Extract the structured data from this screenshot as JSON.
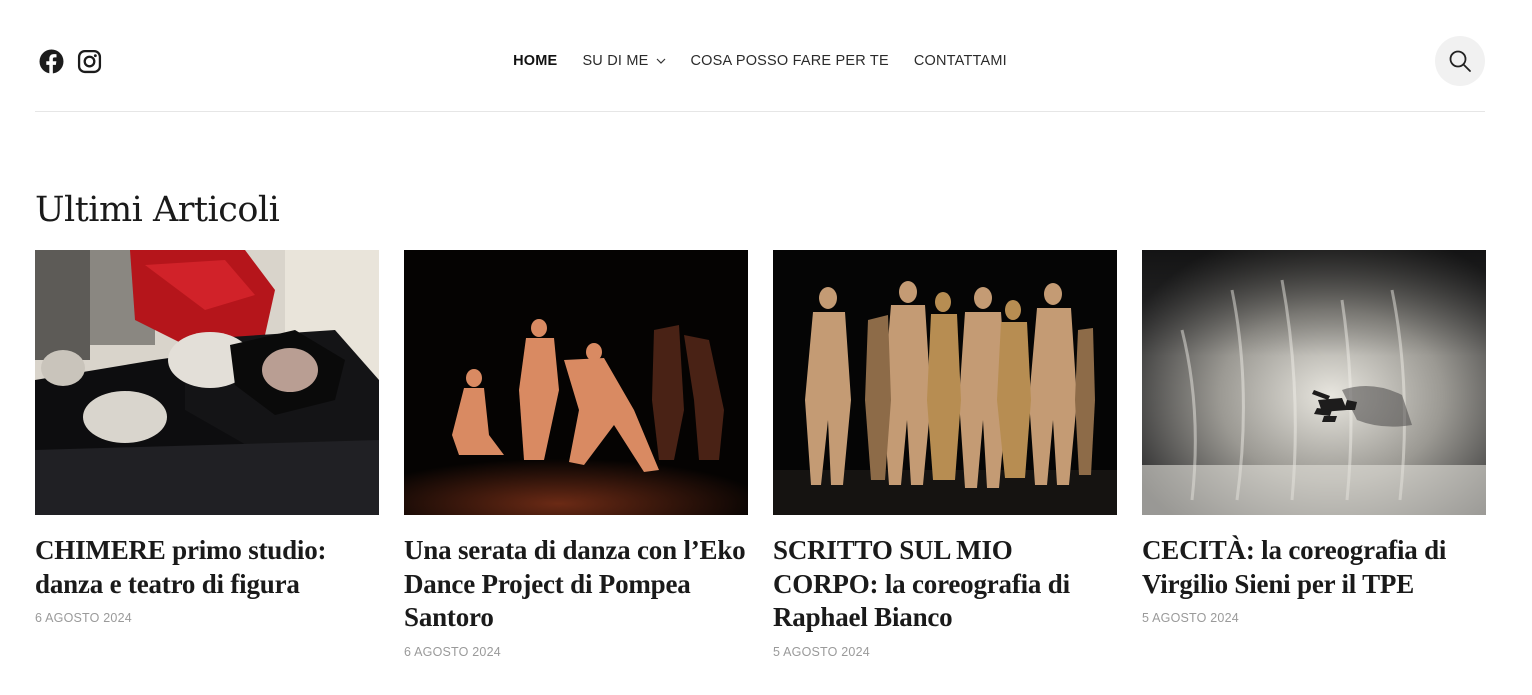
{
  "header": {
    "social": [
      {
        "icon": "facebook-icon"
      },
      {
        "icon": "instagram-icon"
      }
    ],
    "nav": [
      {
        "label": "HOME",
        "active": true
      },
      {
        "label": "SU DI ME",
        "has_dropdown": true
      },
      {
        "label": "COSA POSSO FARE PER TE"
      },
      {
        "label": "CONTATTAMI"
      }
    ],
    "search_icon": "search-icon"
  },
  "main": {
    "section_title": "Ultimi Articoli",
    "posts": [
      {
        "title": "CHIMERE primo studio: danza e teatro di figura",
        "date": "6 AGOSTO 2024"
      },
      {
        "title": "Una serata di danza con l’Eko Dance Project di Pompea Santoro",
        "date": "6 AGOSTO 2024"
      },
      {
        "title": "SCRITTO SUL MIO CORPO: la coreografia di Raphael Bianco",
        "date": "5 AGOSTO 2024"
      },
      {
        "title": "CECITÀ: la coreografia di Virgilio Sieni per il TPE",
        "date": "5 AGOSTO 2024"
      }
    ]
  },
  "colors": {
    "text": "#1a1a1a",
    "date": "#9a9a9a",
    "divider": "#e6e6e6",
    "search_bg": "#f1f1f1"
  }
}
